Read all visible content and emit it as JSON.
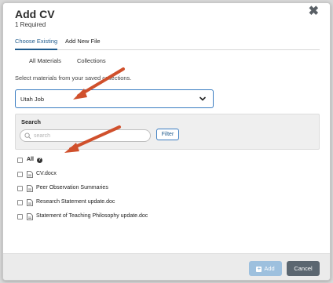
{
  "modal": {
    "title": "Add CV",
    "subtitle": "1 Required",
    "close_icon": "close-icon"
  },
  "tabs": [
    {
      "label": "Choose Existing",
      "active": true
    },
    {
      "label": "Add New File",
      "active": false
    }
  ],
  "subtabs": [
    {
      "label": "All Materials"
    },
    {
      "label": "Collections"
    }
  ],
  "description": "Select materials from your saved collections.",
  "collection_select": {
    "value": "Utah Job"
  },
  "search": {
    "label": "Search",
    "placeholder": "search",
    "filter_label": "Filter"
  },
  "materials": {
    "all_label": "All",
    "items": [
      {
        "label": "CV.docx"
      },
      {
        "label": "Peer Observation Summaries"
      },
      {
        "label": "Research Statement update.doc"
      },
      {
        "label": "Statement of Teaching Philosophy update.doc"
      }
    ]
  },
  "footer": {
    "add_label": "Add",
    "cancel_label": "Cancel"
  },
  "colors": {
    "accent": "#1e5a8c",
    "add_button": "#9dc0de",
    "cancel_button": "#5b6670",
    "annotation_arrow": "#d0502c"
  }
}
